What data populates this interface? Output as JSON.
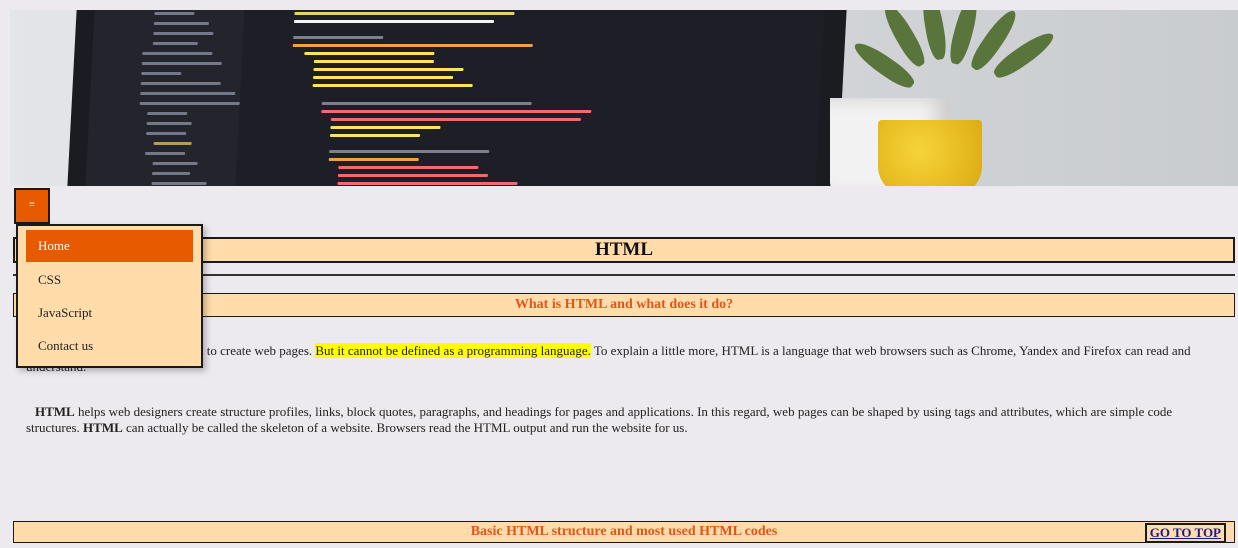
{
  "menu": {
    "toggle_label": "≡",
    "items": [
      {
        "label": "Home",
        "active": true
      },
      {
        "label": "CSS",
        "active": false
      },
      {
        "label": "JavaScript",
        "active": false
      },
      {
        "label": "Contact us",
        "active": false
      }
    ]
  },
  "page_title": "HTML",
  "section1": {
    "heading": "What is HTML and what does it do?",
    "paragraph1": {
      "part1": "HTML is a markup language used to create web pages. ",
      "highlight": "But it cannot be defined as a programming language.",
      "part2": " To explain a little more, HTML is a language that web browsers such as Chrome, Yandex and Firefox can read and understand."
    },
    "paragraph2": {
      "bold1": "HTML",
      "part1": " helps web designers create structure profiles, links, block quotes, paragraphs, and headings for pages and applications. In this regard, web pages can be shaped by using tags and attributes, which are simple code structures. ",
      "bold2": "HTML",
      "part2": " can actually be called the skeleton of a website. Browsers read the HTML output and run the website for us."
    }
  },
  "section2": {
    "heading": "Basic HTML structure and most used HTML codes"
  },
  "goto_top_label": "GO TO TOP",
  "colors": {
    "accent": "#e85a00",
    "bar_background": "#ffdcaa",
    "heading_text": "#e0561b",
    "highlight": "#ffff00",
    "page_background": "#ece9ef"
  }
}
